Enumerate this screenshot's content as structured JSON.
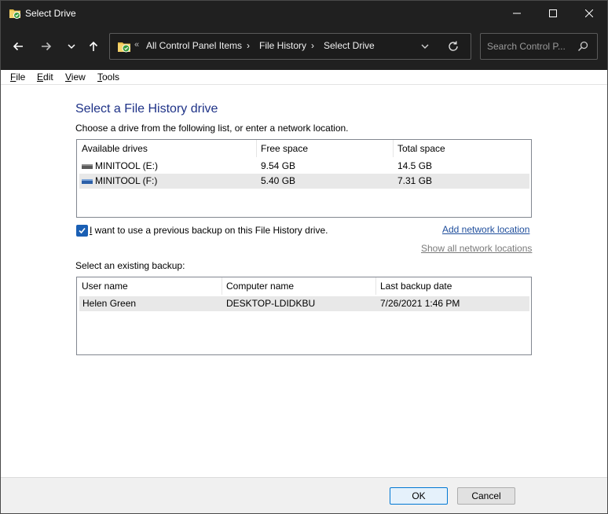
{
  "window": {
    "title": "Select Drive"
  },
  "breadcrumb": {
    "overflow": "«",
    "items": [
      "All Control Panel Items",
      "File History",
      "Select Drive"
    ]
  },
  "search": {
    "placeholder": "Search Control P..."
  },
  "menu": {
    "items": [
      {
        "label": "File",
        "mnemonic": "F",
        "rest": "ile"
      },
      {
        "label": "Edit",
        "mnemonic": "E",
        "rest": "dit"
      },
      {
        "label": "View",
        "mnemonic": "V",
        "rest": "iew"
      },
      {
        "label": "Tools",
        "mnemonic": "T",
        "rest": "ools"
      }
    ]
  },
  "main": {
    "heading": "Select a File History drive",
    "instruction": "Choose a drive from the following list, or enter a network location."
  },
  "drives": {
    "columns": [
      "Available drives",
      "Free space",
      "Total space"
    ],
    "rows": [
      {
        "name": "MINITOOL (E:)",
        "free": "9.54 GB",
        "total": "14.5 GB",
        "selected": false
      },
      {
        "name": "MINITOOL (F:)",
        "free": "5.40 GB",
        "total": "7.31 GB",
        "selected": true
      }
    ]
  },
  "previous_backup": {
    "checked": true,
    "label_prefix": "I",
    "label_rest": " want to use a previous backup on this File History drive."
  },
  "links": {
    "add_network": "Add network location",
    "show_network": "Show all network locations"
  },
  "backups": {
    "label": "Select an existing backup:",
    "columns": [
      "User name",
      "Computer name",
      "Last backup date"
    ],
    "rows": [
      {
        "user": "Helen Green",
        "computer": "DESKTOP-LDIDKBU",
        "date": "7/26/2021 1:46 PM",
        "selected": true
      }
    ]
  },
  "buttons": {
    "ok": "OK",
    "cancel": "Cancel"
  },
  "colors": {
    "accent": "#0078d4",
    "heading": "#1e3287",
    "link": "#1f4e9c",
    "titlebar": "#202020"
  },
  "icons": {
    "app": "file-history-icon",
    "back": "arrow-left-icon",
    "forward": "arrow-right-icon",
    "recent": "chevron-down-icon",
    "up": "arrow-up-icon",
    "refresh": "refresh-icon",
    "search": "search-icon",
    "minimize": "minimize-icon",
    "maximize": "maximize-icon",
    "close": "close-icon"
  }
}
